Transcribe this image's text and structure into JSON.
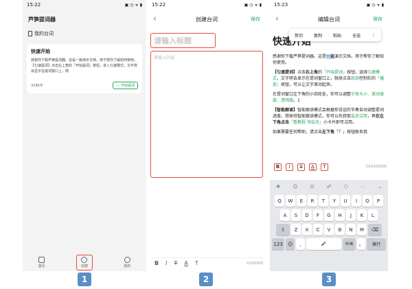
{
  "panel1": {
    "time": "15:22",
    "status_icons": "▣ ◷ ᯤ ▮",
    "app_title": "芦笋提词器",
    "my_scripts_label": "我的台词",
    "card": {
      "title": "快速开始",
      "body": "感谢你下载芦笋提词器。这是一篇演示文档，用于帮你了解如何使用。【匀速提词】点击右上角的「开始提词」按钮，进入匀速模式，文字将会显示在提词窗口上，随",
      "word_count": "3286字",
      "start_button": "开始提词"
    },
    "nav": {
      "home": "首页",
      "create": "创建",
      "mine": "我的"
    }
  },
  "panel2": {
    "time": "15:22",
    "status_icons": "▣ ◷ ᯤ ▮",
    "back": "‹",
    "title": "创建台词",
    "save": "保存",
    "title_placeholder": "请输入标题",
    "content_placeholder": "请输入内容",
    "toolbar": {
      "bold": "B",
      "italic": "I",
      "strike": "T",
      "color": "A",
      "clear": "T"
    },
    "count": "0/100000"
  },
  "panel3": {
    "time": "15:23",
    "status_icons": "▣ ◷ ᯤ ▮",
    "back": "‹",
    "title": "编辑台词",
    "save": "保存",
    "heading": "快速开始",
    "context_menu": {
      "cut": "剪切",
      "copy": "复制",
      "paste": "粘贴",
      "select_all": "全选",
      "more": "⋮"
    },
    "para1_a": "感谢你下载芦笋提词器。这是",
    "para1_sel": "一篇",
    "para1_b": "演示文档，用于帮你了解如何使用。",
    "para2_a": "【匀速提词】",
    "para2_b": "点击",
    "para2_c": "右上角",
    "para2_d": "的",
    "para2_e": "「开始提词」",
    "para2_f": "按钮，选择",
    "para2_g": "匀速模式",
    "para2_h": "，文字将会显示在提词窗口上，就续点击",
    "para2_i": "底部",
    "para2_j": "控制栏的",
    "para2_k": "「播放」",
    "para2_l": "按钮，可以让文字滚动起来。",
    "para3_a": "在提词窗口左下角的小齿轮处，你可以调整",
    "para3_b": "字体大小、滚动速度、透明度",
    "para3_c": "。1",
    "para4_a": "【智能跟读】",
    "para4_b": "智能跟读模式会根据你说话的节奏自动调整提词进度。想体验智能跟读模式，你可以先获取",
    "para4_c": "会员试用",
    "para4_d": "，再",
    "para4_e": "在左下角点击",
    "para4_f": "「看教程 领会员」",
    "para4_g": "小卡片即可试用。",
    "para5_a": "如果需要任何帮助，请点击",
    "para5_b": "左下角",
    "para5_c": "「？」按钮联系我",
    "format_bar": {
      "bold": "B",
      "italic": "I",
      "strike": "T",
      "color": "A",
      "clear": "T"
    },
    "count": "234/100000",
    "keyboard": {
      "toolbar": [
        "❖",
        "☺",
        "⊡",
        "☍",
        "⬡",
        "⋯",
        "⌄"
      ],
      "row1": [
        "Q",
        "W",
        "E",
        "R",
        "T",
        "Y",
        "U",
        "I",
        "O",
        "P"
      ],
      "row2": [
        "A",
        "S",
        "D",
        "F",
        "G",
        "H",
        "J",
        "K",
        "L"
      ],
      "row3": [
        "⇧",
        "Z",
        "X",
        "C",
        "V",
        "B",
        "N",
        "M",
        "⌫"
      ],
      "row4": [
        "123",
        "☺",
        ",",
        "🎤",
        "中/英",
        "。",
        "换行"
      ]
    }
  },
  "badges": [
    "1",
    "2",
    "3"
  ]
}
